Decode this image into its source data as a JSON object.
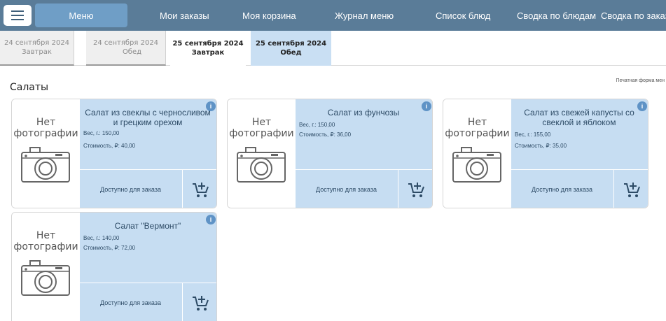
{
  "nav": {
    "items": [
      {
        "label": "Меню"
      },
      {
        "label": "Мои заказы"
      },
      {
        "label": "Моя корзина"
      },
      {
        "label": "Журнал меню"
      },
      {
        "label": "Список блюд"
      },
      {
        "label": "Сводка по блюдам"
      },
      {
        "label": "Сводка по заказа"
      }
    ]
  },
  "tabs": [
    {
      "date": "24 сентября 2024",
      "meal": "Завтрак"
    },
    {
      "date": "24 сентября 2024",
      "meal": "Обед"
    },
    {
      "date": "25 сентября 2024",
      "meal": "Завтрак"
    },
    {
      "date": "25 сентября 2024",
      "meal": "Обед"
    }
  ],
  "print_link": "Печатная форма мен",
  "section_title": "Салаты",
  "no_photo": {
    "line1": "Нет",
    "line2": "фотографии"
  },
  "dishes": [
    {
      "name": "Салат из свеклы с черносливом и грецким орехом",
      "weight": "Вес, г.: 150,00",
      "price": "Стоимость, ₽: 40,00",
      "availability": "Доступно для заказа"
    },
    {
      "name": "Салат из фунчозы",
      "weight": "Вес, г.: 150,00",
      "price": "Стоимость, ₽: 36,00",
      "availability": "Доступно для заказа"
    },
    {
      "name": "Салат из свежей капусты со свеклой и яблоком",
      "weight": "Вес, г.: 155,00",
      "price": "Стоимость, ₽: 35,00",
      "availability": "Доступно для заказа"
    },
    {
      "name": "Салат \"Вермонт\"",
      "weight": "Вес, г.: 140,00",
      "price": "Стоимость, ₽: 72,00",
      "availability": "Доступно для заказа"
    }
  ],
  "colors": {
    "nav_bg": "#5a7c98",
    "nav_active": "#6f9ec6",
    "card_accent": "#c6ddf2",
    "tab_selected": "#c9dff3"
  },
  "icons": {
    "menu": "hamburger-icon",
    "info": "info-icon",
    "camera": "camera-icon",
    "cart": "add-to-cart-icon"
  }
}
